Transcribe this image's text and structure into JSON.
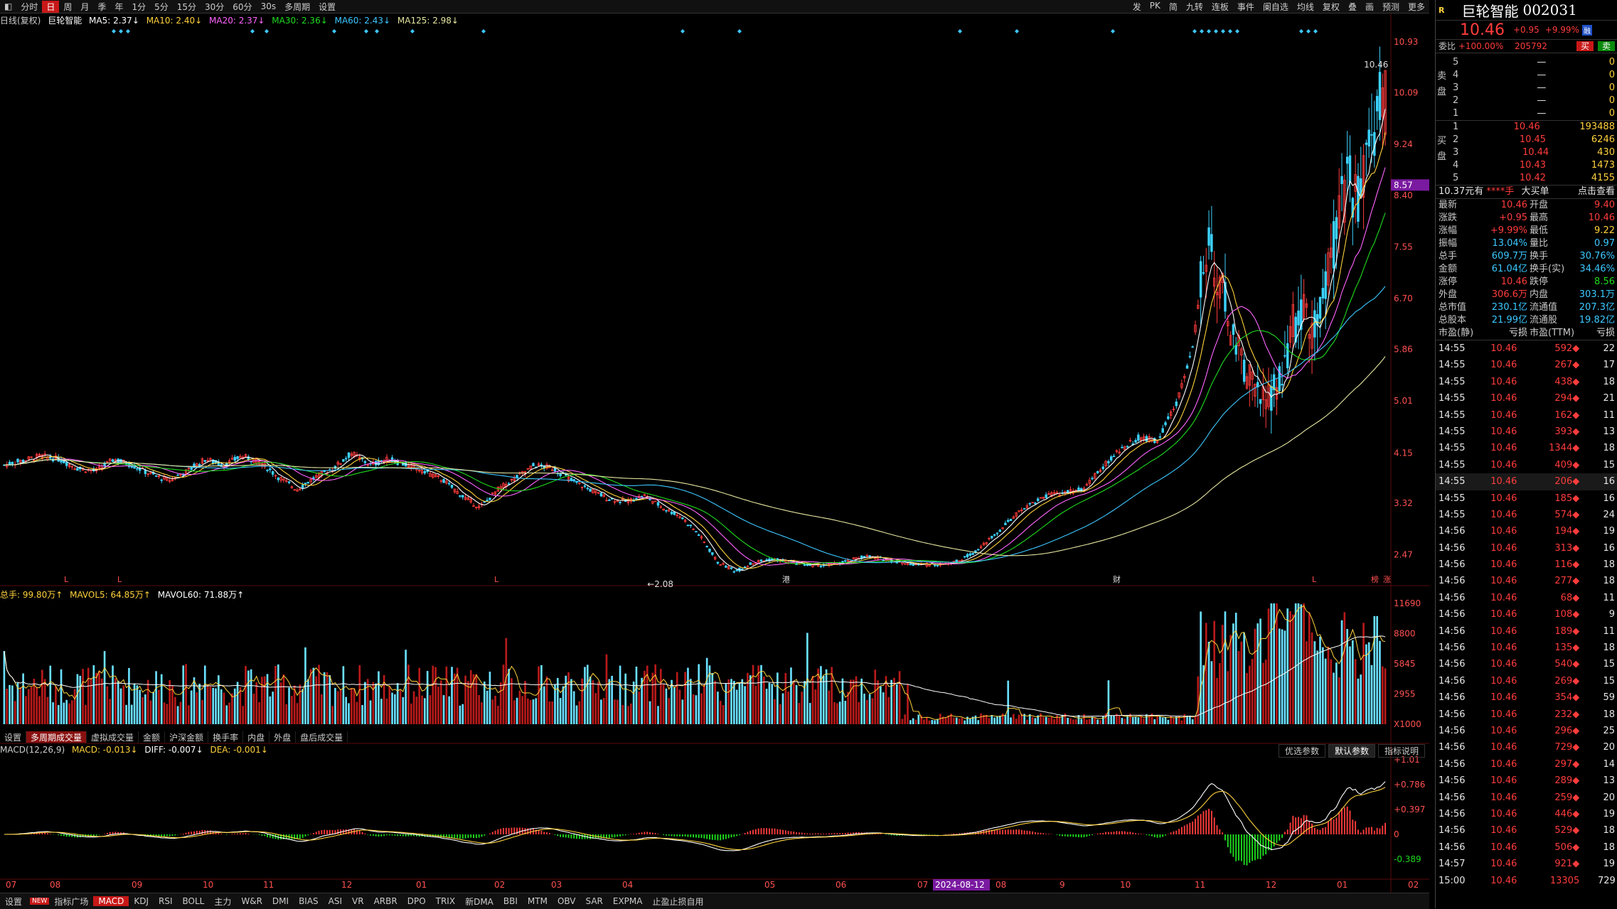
{
  "toolbar": {
    "periods": [
      "分时",
      "日",
      "周",
      "月",
      "季",
      "年",
      "1分",
      "5分",
      "15分",
      "30分",
      "60分",
      "30s",
      "多周期",
      "设置"
    ],
    "active_period": "日",
    "right_items": [
      "发",
      "PK",
      "简",
      "九转",
      "连板",
      "事件",
      "阑自选",
      "均线",
      "复权",
      "叠",
      "画",
      "预测",
      "更多"
    ]
  },
  "chart_header": {
    "name": "日线(复权)",
    "stock": "巨轮智能",
    "ma5": "MA5: 2.37↓",
    "ma10": "MA10: 2.40↓",
    "ma20": "MA20: 2.37↓",
    "ma30": "MA30: 2.36↓",
    "ma60": "MA60: 2.43↓",
    "ma125": "MA125: 2.98↓"
  },
  "vol_header": {
    "total": "总手: 99.80万↑",
    "mavol5": "MAVOL5: 64.85万↑",
    "mavol60": "MAVOL60: 71.88万↑"
  },
  "macd_header": {
    "name": "MACD(12,26,9)",
    "macd": "MACD: -0.013↓",
    "diff": "DIFF: -0.007↓",
    "dea": "DEA: -0.001↓"
  },
  "vol_tabs": [
    "设置",
    "多周期成交量",
    "虚拟成交量",
    "金额",
    "沪深金额",
    "换手率",
    "内盘",
    "外盘",
    "盘后成交量"
  ],
  "vol_tab_active": "多周期成交量",
  "macd_buttons": [
    "优选参数",
    "默认参数",
    "指标说明"
  ],
  "macd_button_active": "默认参数",
  "bottom_tabs": [
    "设置",
    "指标广场",
    "MACD",
    "KDJ",
    "RSI",
    "BOLL",
    "主力",
    "W&R",
    "DMI",
    "BIAS",
    "ASI",
    "VR",
    "ARBR",
    "DPO",
    "TRIX",
    "新DMA",
    "BBI",
    "MTM",
    "OBV",
    "SAR",
    "EXPMA",
    "止盈止损自用"
  ],
  "bottom_new_badge": "NEW",
  "bottom_tab_active": "MACD",
  "chart_data": {
    "type": "candlestick",
    "price_ticks": [
      "10.93",
      "10.09",
      "9.24",
      "8.40",
      "7.55",
      "6.70",
      "5.86",
      "5.01",
      "4.15",
      "3.32",
      "2.47"
    ],
    "price_range": [
      2.08,
      10.93
    ],
    "high_label": "10.46",
    "low_label": "←2.08",
    "current_price_tag": "8.57",
    "volume_ticks": [
      "11690",
      "8800",
      "5845",
      "2955",
      "X1000"
    ],
    "macd_ticks": [
      "+1.01",
      "+0.786",
      "+0.397",
      "0",
      "-0.389"
    ],
    "x_months": [
      "07",
      "08",
      "09",
      "10",
      "11",
      "12",
      "01",
      "02",
      "03",
      "04",
      "05",
      "06",
      "07",
      "08",
      "9",
      "10",
      "11",
      "12",
      "01",
      "02"
    ],
    "x_highlight": "2024-08-12",
    "event_markers": [
      "L",
      "L",
      "L",
      "港",
      "财",
      "L",
      "榜",
      "涨"
    ],
    "closes_anchor": [
      [
        0,
        3.95
      ],
      [
        40,
        4.1
      ],
      [
        60,
        4.05
      ],
      [
        80,
        3.9
      ],
      [
        100,
        3.85
      ],
      [
        120,
        4.05
      ],
      [
        140,
        3.95
      ],
      [
        160,
        3.8
      ],
      [
        180,
        3.7
      ],
      [
        200,
        3.85
      ],
      [
        220,
        4.05
      ],
      [
        240,
        3.95
      ],
      [
        260,
        4.1
      ],
      [
        280,
        4.0
      ],
      [
        300,
        3.75
      ],
      [
        320,
        3.55
      ],
      [
        340,
        3.75
      ],
      [
        360,
        3.9
      ],
      [
        380,
        4.15
      ],
      [
        400,
        3.95
      ],
      [
        420,
        4.05
      ],
      [
        440,
        3.95
      ],
      [
        460,
        3.85
      ],
      [
        480,
        3.7
      ],
      [
        500,
        3.45
      ],
      [
        520,
        3.25
      ],
      [
        540,
        3.55
      ],
      [
        560,
        3.75
      ],
      [
        580,
        3.95
      ],
      [
        600,
        3.9
      ],
      [
        620,
        3.7
      ],
      [
        640,
        3.55
      ],
      [
        660,
        3.4
      ],
      [
        680,
        3.35
      ],
      [
        700,
        3.45
      ],
      [
        720,
        3.25
      ],
      [
        740,
        3.1
      ],
      [
        760,
        2.8
      ],
      [
        780,
        2.35
      ],
      [
        800,
        2.2
      ],
      [
        820,
        2.35
      ],
      [
        840,
        2.4
      ],
      [
        860,
        2.35
      ],
      [
        880,
        2.3
      ],
      [
        900,
        2.3
      ],
      [
        920,
        2.35
      ],
      [
        940,
        2.45
      ],
      [
        960,
        2.4
      ],
      [
        980,
        2.35
      ],
      [
        1000,
        2.3
      ],
      [
        1020,
        2.32
      ],
      [
        1040,
        2.35
      ],
      [
        1060,
        2.5
      ],
      [
        1080,
        2.75
      ],
      [
        1100,
        3.05
      ],
      [
        1120,
        3.3
      ],
      [
        1140,
        3.45
      ],
      [
        1160,
        3.5
      ],
      [
        1180,
        3.55
      ],
      [
        1200,
        3.9
      ],
      [
        1220,
        4.2
      ],
      [
        1240,
        4.4
      ],
      [
        1260,
        4.35
      ],
      [
        1280,
        4.9
      ],
      [
        1300,
        5.9
      ],
      [
        1310,
        7.2
      ],
      [
        1320,
        7.5
      ],
      [
        1330,
        7.0
      ],
      [
        1340,
        6.2
      ],
      [
        1350,
        5.8
      ],
      [
        1360,
        5.5
      ],
      [
        1370,
        5.1
      ],
      [
        1380,
        4.95
      ],
      [
        1390,
        5.3
      ],
      [
        1400,
        5.6
      ],
      [
        1410,
        6.3
      ],
      [
        1420,
        6.5
      ],
      [
        1430,
        6.2
      ],
      [
        1440,
        6.6
      ],
      [
        1450,
        7.3
      ],
      [
        1460,
        8.1
      ],
      [
        1470,
        8.6
      ],
      [
        1480,
        8.3
      ],
      [
        1490,
        9.1
      ],
      [
        1500,
        9.6
      ],
      [
        1510,
        10.46
      ]
    ]
  },
  "quote": {
    "logo": "R",
    "name": "巨轮智能",
    "code": "002031",
    "price": "10.46",
    "change": "+0.95",
    "change_pct": "+9.99%",
    "badge": "融",
    "weibi_label": "委比",
    "weibi": "+100.00%",
    "weicha": "205792",
    "buy_btn": "买",
    "sell_btn": "卖",
    "sell_side_label": "卖盘",
    "buy_side_label": "买盘",
    "asks": [
      {
        "lvl": "5",
        "price": "—",
        "vol": "0"
      },
      {
        "lvl": "4",
        "price": "—",
        "vol": "0"
      },
      {
        "lvl": "3",
        "price": "—",
        "vol": "0"
      },
      {
        "lvl": "2",
        "price": "—",
        "vol": "0"
      },
      {
        "lvl": "1",
        "price": "—",
        "vol": "0"
      }
    ],
    "bids": [
      {
        "lvl": "1",
        "price": "10.46",
        "vol": "193488"
      },
      {
        "lvl": "2",
        "price": "10.45",
        "vol": "6246"
      },
      {
        "lvl": "3",
        "price": "10.44",
        "vol": "430"
      },
      {
        "lvl": "4",
        "price": "10.43",
        "vol": "1473"
      },
      {
        "lvl": "5",
        "price": "10.42",
        "vol": "4155"
      }
    ],
    "bigorder": {
      "price": "10.37元有",
      "vol": "****手",
      "label": "大买单",
      "link": "点击查看"
    },
    "stats": [
      [
        "最新",
        "10.46",
        "开盘",
        "9.40"
      ],
      [
        "涨跌",
        "+0.95",
        "最高",
        "10.46"
      ],
      [
        "涨幅",
        "+9.99%",
        "最低",
        "9.22"
      ],
      [
        "振幅",
        "13.04%",
        "量比",
        "0.97"
      ],
      [
        "总手",
        "609.7万",
        "换手",
        "30.76%"
      ],
      [
        "金额",
        "61.04亿",
        "换手(实)",
        "34.46%"
      ],
      [
        "涨停",
        "10.46",
        "跌停",
        "8.56"
      ],
      [
        "外盘",
        "306.6万",
        "内盘",
        "303.1万"
      ],
      [
        "总市值",
        "230.1亿",
        "流通值",
        "207.3亿"
      ],
      [
        "总股本",
        "21.99亿",
        "流通股",
        "19.82亿"
      ],
      [
        "市盈(静)",
        "亏损",
        "市盈(TTM)",
        "亏损"
      ]
    ],
    "ticks": [
      {
        "t": "14:55",
        "p": "10.46",
        "v": "592",
        "d": "22"
      },
      {
        "t": "14:55",
        "p": "10.46",
        "v": "267",
        "d": "17"
      },
      {
        "t": "14:55",
        "p": "10.46",
        "v": "438",
        "d": "18"
      },
      {
        "t": "14:55",
        "p": "10.46",
        "v": "294",
        "d": "21"
      },
      {
        "t": "14:55",
        "p": "10.46",
        "v": "162",
        "d": "11"
      },
      {
        "t": "14:55",
        "p": "10.46",
        "v": "393",
        "d": "13"
      },
      {
        "t": "14:55",
        "p": "10.46",
        "v": "1344",
        "d": "18"
      },
      {
        "t": "14:55",
        "p": "10.46",
        "v": "409",
        "d": "15"
      },
      {
        "t": "14:55",
        "p": "10.46",
        "v": "206",
        "d": "16"
      },
      {
        "t": "14:55",
        "p": "10.46",
        "v": "185",
        "d": "16"
      },
      {
        "t": "14:55",
        "p": "10.46",
        "v": "574",
        "d": "24"
      },
      {
        "t": "14:56",
        "p": "10.46",
        "v": "194",
        "d": "19"
      },
      {
        "t": "14:56",
        "p": "10.46",
        "v": "313",
        "d": "16"
      },
      {
        "t": "14:56",
        "p": "10.46",
        "v": "116",
        "d": "18"
      },
      {
        "t": "14:56",
        "p": "10.46",
        "v": "277",
        "d": "18"
      },
      {
        "t": "14:56",
        "p": "10.46",
        "v": "68",
        "d": "11"
      },
      {
        "t": "14:56",
        "p": "10.46",
        "v": "108",
        "d": "9"
      },
      {
        "t": "14:56",
        "p": "10.46",
        "v": "189",
        "d": "11"
      },
      {
        "t": "14:56",
        "p": "10.46",
        "v": "135",
        "d": "18"
      },
      {
        "t": "14:56",
        "p": "10.46",
        "v": "540",
        "d": "15"
      },
      {
        "t": "14:56",
        "p": "10.46",
        "v": "269",
        "d": "15"
      },
      {
        "t": "14:56",
        "p": "10.46",
        "v": "354",
        "d": "59"
      },
      {
        "t": "14:56",
        "p": "10.46",
        "v": "232",
        "d": "18"
      },
      {
        "t": "14:56",
        "p": "10.46",
        "v": "296",
        "d": "25"
      },
      {
        "t": "14:56",
        "p": "10.46",
        "v": "729",
        "d": "20"
      },
      {
        "t": "14:56",
        "p": "10.46",
        "v": "297",
        "d": "14"
      },
      {
        "t": "14:56",
        "p": "10.46",
        "v": "289",
        "d": "13"
      },
      {
        "t": "14:56",
        "p": "10.46",
        "v": "259",
        "d": "20"
      },
      {
        "t": "14:56",
        "p": "10.46",
        "v": "446",
        "d": "19"
      },
      {
        "t": "14:56",
        "p": "10.46",
        "v": "529",
        "d": "18"
      },
      {
        "t": "14:56",
        "p": "10.46",
        "v": "506",
        "d": "18"
      },
      {
        "t": "14:57",
        "p": "10.46",
        "v": "921",
        "d": "19"
      },
      {
        "t": "15:00",
        "p": "10.46",
        "v": "13305",
        "d": "729"
      }
    ]
  },
  "colors": {
    "up": "#ff3c3c",
    "down": "#3cd2ff",
    "ma5": "#ffffff",
    "ma10": "#ffd23c",
    "ma20": "#ff64ff",
    "ma30": "#1edc1e",
    "ma60": "#3cc8ff",
    "ma125": "#e6e6a0"
  }
}
